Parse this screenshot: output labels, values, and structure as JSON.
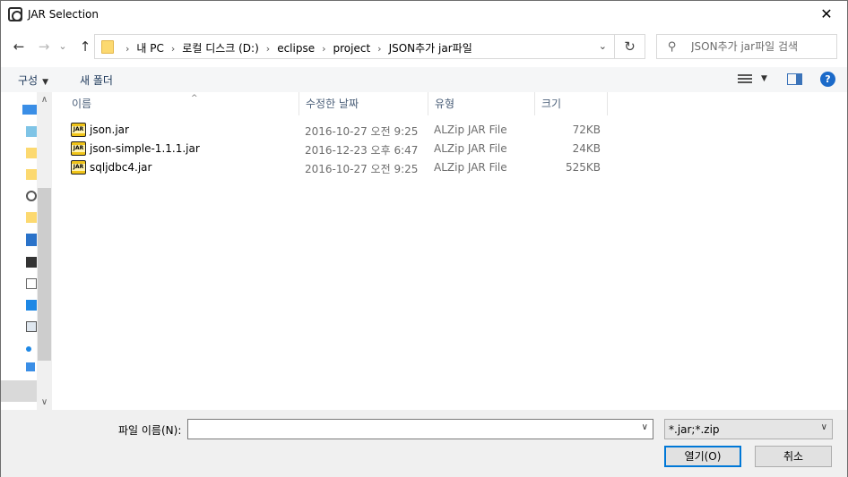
{
  "window": {
    "title": "JAR Selection",
    "close_glyph": "✕"
  },
  "nav": {
    "back_glyph": "←",
    "forward_glyph": "→",
    "recent_glyph": "⌄",
    "up_glyph": "↑"
  },
  "address": {
    "crumbs": [
      "내 PC",
      "로컬 디스크 (D:)",
      "eclipse",
      "project",
      "JSON추가 jar파일"
    ],
    "separator": "›",
    "dropdown_glyph": "⌄",
    "refresh_glyph": "↻"
  },
  "search": {
    "placeholder": "JSON추가 jar파일 검색",
    "icon": "search-icon",
    "icon_glyph": "⚲"
  },
  "toolbar": {
    "organize": "구성",
    "organize_caret": "▼",
    "new_folder": "새 폴더",
    "view_caret": "▼",
    "help_glyph": "?"
  },
  "navpane": {
    "up_glyph": "∧",
    "down_glyph": "∨"
  },
  "columns": {
    "name": "이름",
    "modified": "수정한 날짜",
    "type": "유형",
    "size": "크기",
    "sort_glyph": "^"
  },
  "files": [
    {
      "name": "json.jar",
      "modified": "2016-10-27 오전 9:25",
      "type": "ALZip JAR File",
      "size": "72KB"
    },
    {
      "name": "json-simple-1.1.1.jar",
      "modified": "2016-12-23 오후 6:47",
      "type": "ALZip JAR File",
      "size": "24KB"
    },
    {
      "name": "sqljdbc4.jar",
      "modified": "2016-10-27 오전 9:25",
      "type": "ALZip JAR File",
      "size": "525KB"
    }
  ],
  "bottom": {
    "filename_label": "파일 이름(N):",
    "filename_value": "",
    "filename_caret": "∨",
    "filter_value": "*.jar;*.zip",
    "filter_caret": "∨",
    "open_label": "열기(O)",
    "cancel_label": "취소"
  },
  "colors": {
    "accent": "#0078d7",
    "toolbar_text": "#1e395b",
    "header_text": "#4c607a",
    "help": "#1b6ac9"
  }
}
